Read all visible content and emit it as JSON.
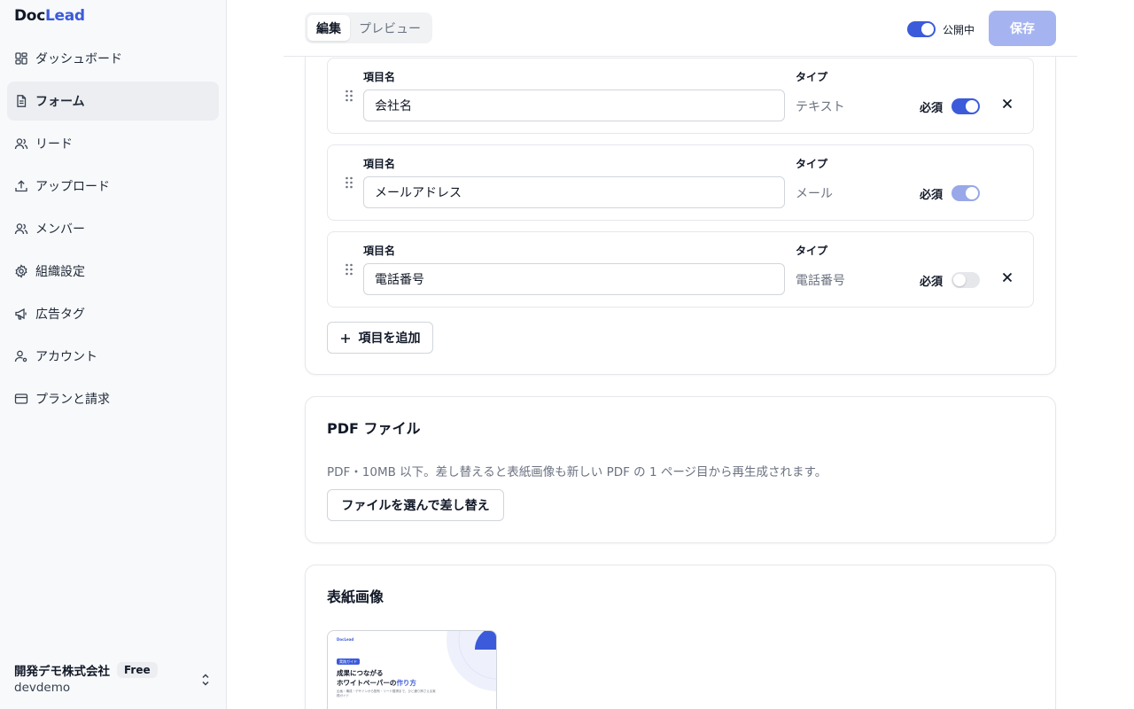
{
  "app": {
    "logo_part1": "Doc",
    "logo_part2": "Lead"
  },
  "sidebar": {
    "items": [
      {
        "label": "ダッシュボード",
        "icon": "dashboard-icon"
      },
      {
        "label": "フォーム",
        "icon": "form-icon",
        "active": true
      },
      {
        "label": "リード",
        "icon": "users-icon"
      },
      {
        "label": "アップロード",
        "icon": "upload-icon"
      },
      {
        "label": "メンバー",
        "icon": "members-icon"
      },
      {
        "label": "組織設定",
        "icon": "gear-icon"
      },
      {
        "label": "広告タグ",
        "icon": "megaphone-icon"
      },
      {
        "label": "アカウント",
        "icon": "account-icon"
      },
      {
        "label": "プランと請求",
        "icon": "credit-card-icon"
      }
    ],
    "org": {
      "name": "開発デモ株式会社",
      "plan": "Free",
      "slug": "devdemo"
    }
  },
  "header": {
    "tabs": [
      {
        "label": "編集",
        "active": true
      },
      {
        "label": "プレビュー",
        "active": false
      }
    ],
    "published_label": "公開中",
    "published": true,
    "save_label": "保存"
  },
  "form_fields": {
    "field_label": "項目名",
    "type_label": "タイプ",
    "required_label": "必須",
    "items": [
      {
        "name": "会社名",
        "type": "テキスト",
        "required": true,
        "deletable": true
      },
      {
        "name": "メールアドレス",
        "type": "メール",
        "required": true,
        "required_locked": true,
        "deletable": false
      },
      {
        "name": "電話番号",
        "type": "電話番号",
        "required": false,
        "deletable": true
      }
    ],
    "add_label": "項目を追加"
  },
  "pdf": {
    "title": "PDF ファイル",
    "description": "PDF・10MB 以下。差し替えると表紙画像も新しい PDF の 1 ページ目から再生成されます。",
    "replace_label": "ファイルを選んで差し替え"
  },
  "cover": {
    "title": "表紙画像",
    "thumb": {
      "brand": "DocLead",
      "tag": "実践ガイド",
      "title_line1": "成果につながる",
      "title_line2_a": "ホワイトペーパーの",
      "title_line2_b": "作り方",
      "subtitle": "企画・構成・デザインから配布・リード獲得まで、ひと通り押さえる実践ガイド"
    }
  },
  "colors": {
    "accent": "#3b5bdb",
    "accent_disabled": "#a5b4f1"
  }
}
